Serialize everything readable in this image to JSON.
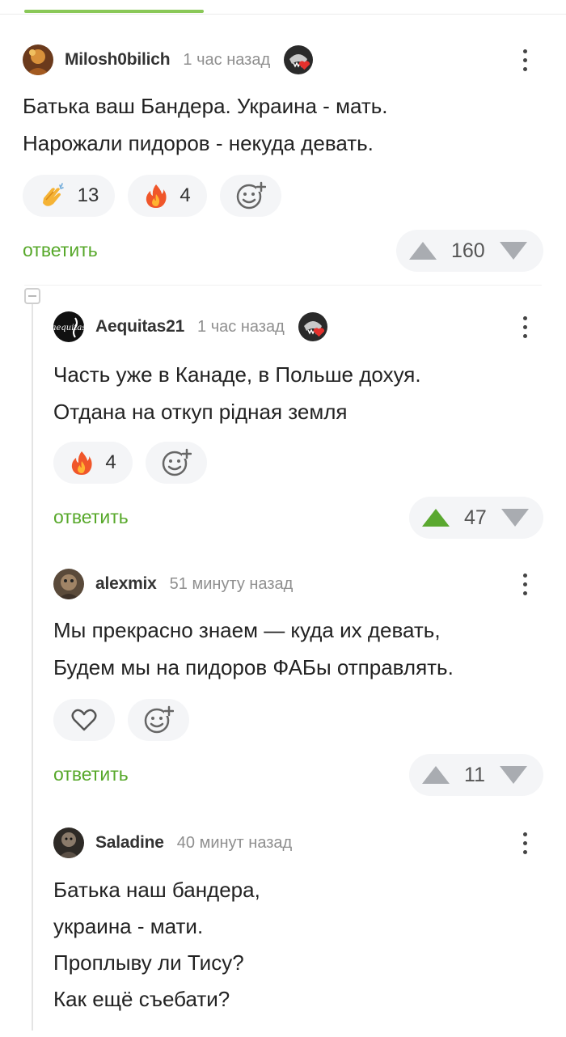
{
  "comments": [
    {
      "author": "Milosh0bilich",
      "time": "1 час назад",
      "has_badge": true,
      "text": "Батька ваш Бандера. Украина - мать.\nНарожали пидоров - некуда девать.",
      "reactions": [
        {
          "icon": "clapping-hands-icon",
          "count": "13"
        },
        {
          "icon": "fire-icon",
          "count": "4"
        },
        {
          "icon": "add-reaction-icon",
          "count": ""
        }
      ],
      "reply_label": "ответить",
      "votes": "160",
      "upvoted": false
    },
    {
      "author": "Aequitas21",
      "time": "1 час назад",
      "has_badge": true,
      "text": "Часть уже в Канаде, в Польше дохуя.\nОтдана на откуп рiдная земля",
      "reactions": [
        {
          "icon": "fire-icon",
          "count": "4"
        },
        {
          "icon": "add-reaction-icon",
          "count": ""
        }
      ],
      "reply_label": "ответить",
      "votes": "47",
      "upvoted": true
    },
    {
      "author": "alexmix",
      "time": "51 минуту назад",
      "has_badge": false,
      "text": "Мы прекрасно знаем — куда их девать,\nБудем мы на пидоров ФАБы отправлять.",
      "reactions": [
        {
          "icon": "heart-icon",
          "count": ""
        },
        {
          "icon": "add-reaction-icon",
          "count": ""
        }
      ],
      "reply_label": "ответить",
      "votes": "11",
      "upvoted": false
    },
    {
      "author": "Saladine",
      "time": "40 минут назад",
      "has_badge": false,
      "text": "Батька наш бандера,\nукраина - мати.\nПроплыву ли Тису?\nКак ещё съебати?"
    }
  ],
  "avatar_texts": {
    "aequitas": "aequitas"
  },
  "colors": {
    "accent_green": "#57a82a",
    "upvote_active": "#5aa82f",
    "pill_bg": "#f4f5f7",
    "time_gray": "#8f8f8f"
  }
}
